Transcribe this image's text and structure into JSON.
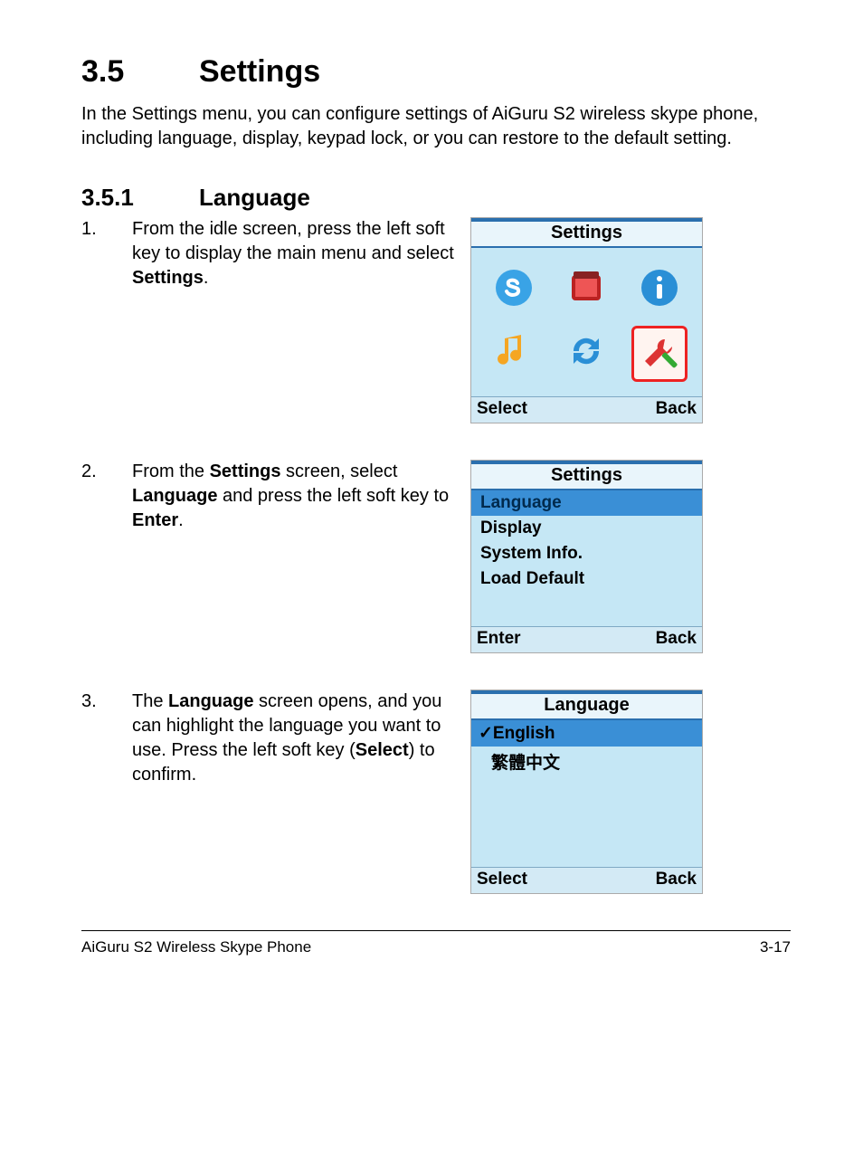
{
  "section": {
    "number": "3.5",
    "title": "Settings"
  },
  "intro": "In the Settings menu, you can configure settings of AiGuru S2 wireless skype phone, including language, display, keypad lock, or you can restore to the default setting.",
  "subsection": {
    "number": "3.5.1",
    "title": "Language"
  },
  "steps": {
    "s1": {
      "num": "1.",
      "pre": "From the idle screen, press the left soft key to display the main menu and select ",
      "b1": "Settings",
      "post": "."
    },
    "s2": {
      "num": "2.",
      "pre": "From the ",
      "b1": "Settings",
      "mid1": " screen, select ",
      "b2": "Language",
      "mid2": " and press the left soft key to ",
      "b3": "Enter",
      "post": "."
    },
    "s3": {
      "num": "3.",
      "pre": "The ",
      "b1": "Language",
      "mid1": " screen opens, and you can highlight the language you want to use. Press the left soft key (",
      "b2": "Select",
      "post": ") to confirm."
    }
  },
  "screen1": {
    "title": "Settings",
    "softleft": "Select",
    "softright": "Back",
    "icons": [
      "skype-icon",
      "contacts-icon",
      "info-icon",
      "music-icon",
      "sync-icon",
      "tools-icon"
    ]
  },
  "screen2": {
    "title": "Settings",
    "items": [
      "Language",
      "Display",
      "System Info.",
      "Load Default"
    ],
    "softleft": "Enter",
    "softright": "Back"
  },
  "screen3": {
    "title": "Language",
    "items": [
      "English",
      "繁體中文"
    ],
    "check": "✓",
    "softleft": "Select",
    "softright": "Back"
  },
  "footer": {
    "left": "AiGuru S2 Wireless Skype Phone",
    "right": "3-17"
  }
}
